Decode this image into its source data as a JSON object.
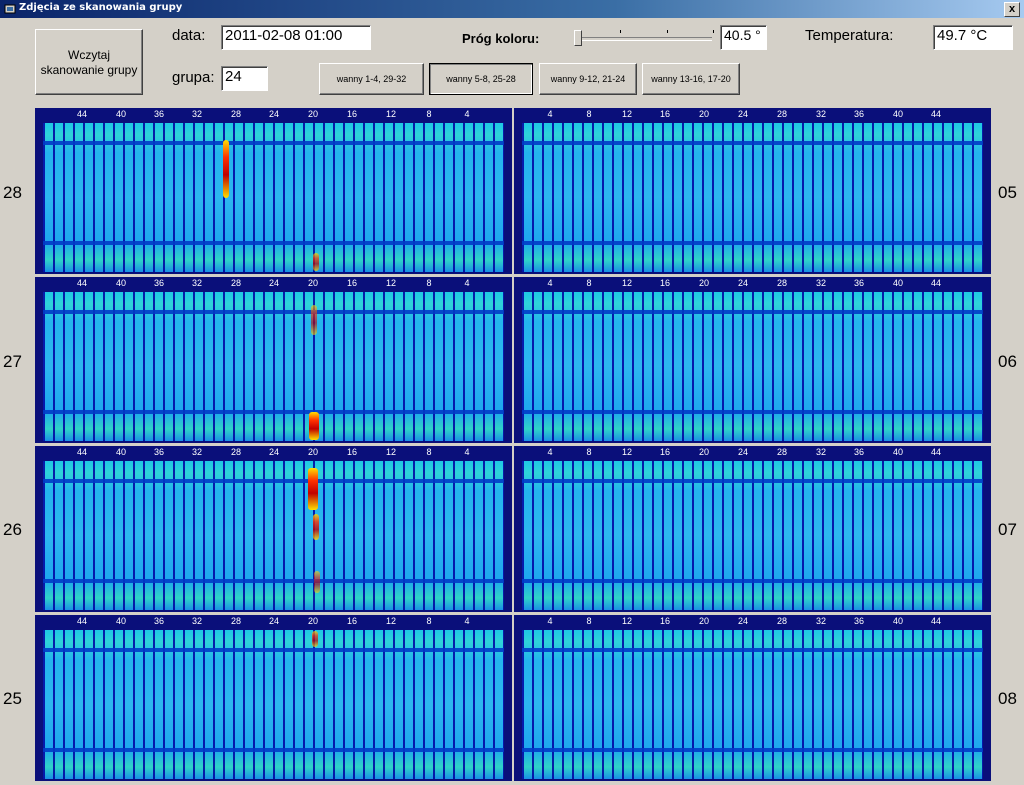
{
  "window": {
    "title": "Zdjęcia ze skanowania grupy",
    "close_label": "x"
  },
  "controls": {
    "load_button": "Wczytaj skanowanie grupy",
    "date_label": "data:",
    "date_value": "2011-02-08 01:00",
    "group_label": "grupa:",
    "group_value": "24",
    "threshold_label": "Próg koloru:",
    "threshold_value": "40.5 °",
    "temperature_label": "Temperatura:",
    "temperature_value": "49.7 °C"
  },
  "tabs": [
    {
      "label": "wanny 1-4, 29-32",
      "selected": false
    },
    {
      "label": "wanny 5-8, 25-28",
      "selected": true
    },
    {
      "label": "wanny 9-12, 21-24",
      "selected": false
    },
    {
      "label": "wanny 13-16, 17-20",
      "selected": false
    }
  ],
  "scale_left": [
    "44",
    "40",
    "36",
    "32",
    "28",
    "24",
    "20",
    "16",
    "12",
    "8",
    "4"
  ],
  "scale_right": [
    "4",
    "8",
    "12",
    "16",
    "20",
    "24",
    "28",
    "32",
    "36",
    "40",
    "44"
  ],
  "rows": [
    {
      "left_label": "28",
      "right_label": "05"
    },
    {
      "left_label": "27",
      "right_label": "06"
    },
    {
      "left_label": "26",
      "right_label": "07"
    },
    {
      "left_label": "25",
      "right_label": "08"
    }
  ]
}
